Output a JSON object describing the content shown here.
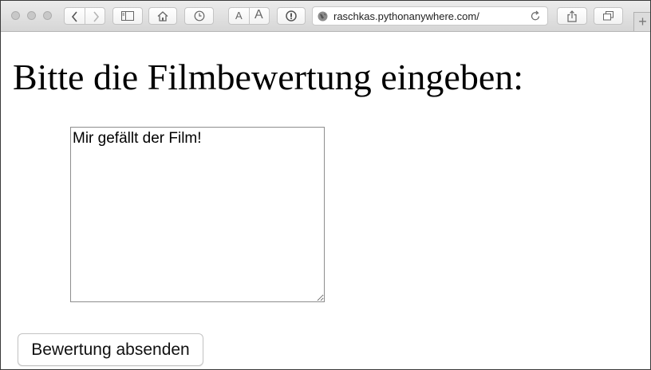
{
  "browser": {
    "url": "raschkas.pythonanywhere.com/",
    "text_size_small_label": "A",
    "text_size_large_label": "A",
    "new_tab_label": "+"
  },
  "page": {
    "heading": "Bitte die Filmbewertung eingeben:",
    "review_field_value": "Mir gefällt der Film!",
    "submit_label": "Bewertung absenden"
  },
  "icons": [
    "back-icon",
    "forward-icon",
    "sidebar-icon",
    "home-icon",
    "history-icon",
    "reader-icon",
    "globe-icon",
    "reload-icon",
    "share-icon",
    "tabs-icon"
  ]
}
